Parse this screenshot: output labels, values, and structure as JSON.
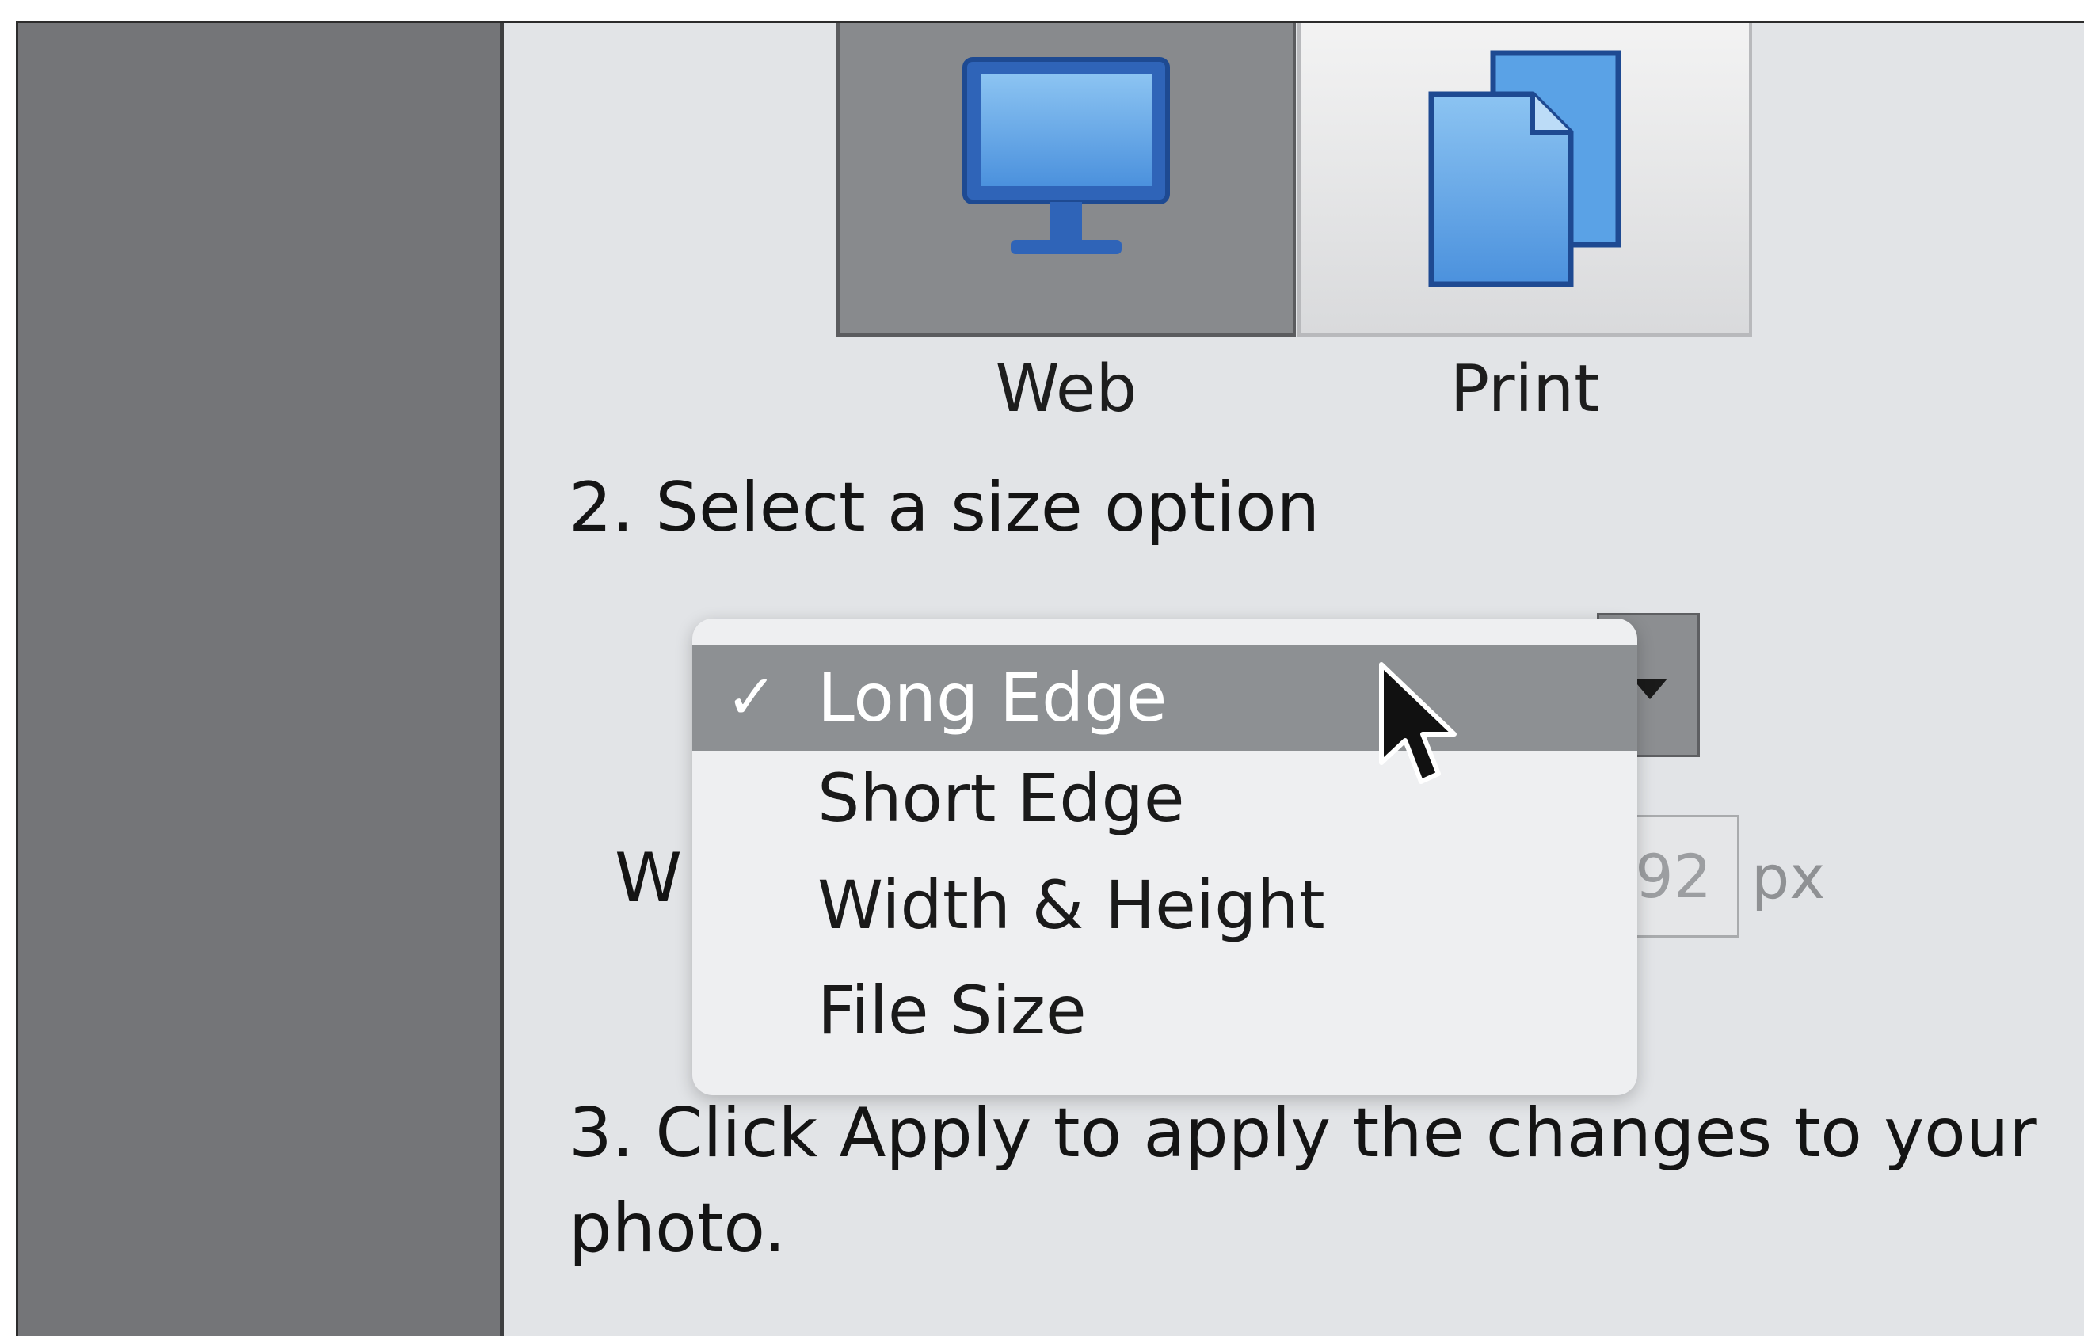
{
  "output_types": [
    {
      "label": "Web",
      "icon": "monitor-icon",
      "selected": true
    },
    {
      "label": "Print",
      "icon": "documents-icon",
      "selected": false
    }
  ],
  "steps": {
    "step2": "2. Select a size option",
    "step3": "3. Click Apply to apply the changes to your photo."
  },
  "size_dropdown": {
    "options": [
      "Long Edge",
      "Short Edge",
      "Width & Height",
      "File Size"
    ],
    "selected_index": 0,
    "checkmark": "✓"
  },
  "behind_menu": {
    "width_label_fragment": "W",
    "field_value_fragment": "92",
    "unit": "px"
  },
  "colors": {
    "selected_highlight": "#8d9093",
    "panel_background": "#e2e4e7",
    "icon_blue": "#3f86d9"
  }
}
